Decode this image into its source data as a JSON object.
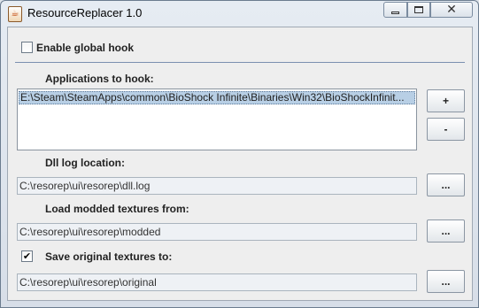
{
  "window": {
    "title": "ResourceReplacer 1.0"
  },
  "titlebar_buttons": {
    "minimize": "minimize-icon",
    "maximize": "maximize-icon",
    "close": "close-icon"
  },
  "global_hook": {
    "label": "Enable global hook",
    "checked": false
  },
  "applications": {
    "label": "Applications to hook:",
    "items": [
      "E:\\Steam\\SteamApps\\common\\BioShock Infinite\\Binaries\\Win32\\BioShockInfinit..."
    ],
    "add_label": "+",
    "remove_label": "-"
  },
  "dll_log": {
    "label": "Dll log location:",
    "value": "C:\\resorep\\ui\\resorep\\dll.log",
    "browse_label": "..."
  },
  "modded": {
    "label": "Load modded textures from:",
    "value": "C:\\resorep\\ui\\resorep\\modded",
    "browse_label": "..."
  },
  "save_original": {
    "label": "Save original textures to:",
    "checked": true,
    "check_glyph": "✔",
    "value": "C:\\resorep\\ui\\resorep\\original",
    "browse_label": "..."
  }
}
